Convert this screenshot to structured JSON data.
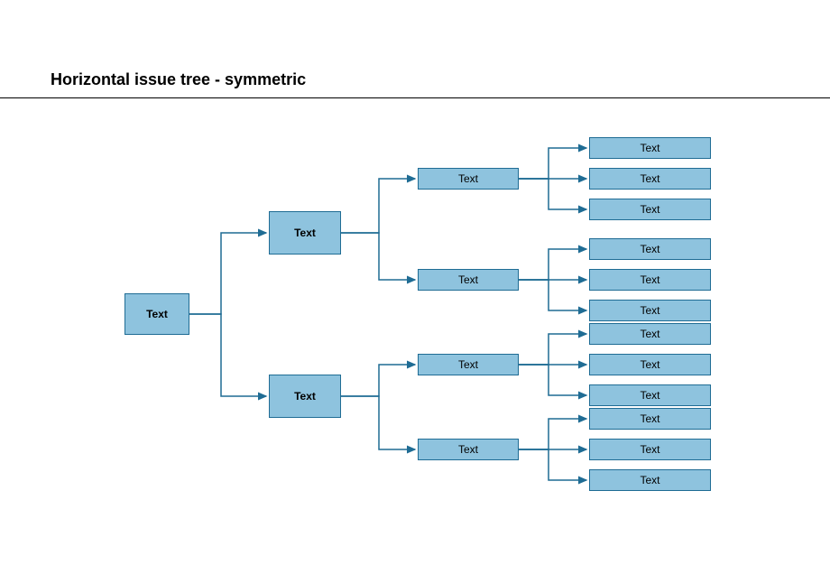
{
  "title": "Horizontal issue tree  - symmetric",
  "colors": {
    "box_fill": "#8ec3de",
    "box_stroke": "#1f6c94",
    "line": "#1f6c94"
  },
  "root": {
    "label": "Text"
  },
  "level2": [
    {
      "label": "Text"
    },
    {
      "label": "Text"
    }
  ],
  "level3": [
    {
      "label": "Text"
    },
    {
      "label": "Text"
    },
    {
      "label": "Text"
    },
    {
      "label": "Text"
    }
  ],
  "level4": [
    {
      "label": "Text"
    },
    {
      "label": "Text"
    },
    {
      "label": "Text"
    },
    {
      "label": "Text"
    },
    {
      "label": "Text"
    },
    {
      "label": "Text"
    },
    {
      "label": "Text"
    },
    {
      "label": "Text"
    },
    {
      "label": "Text"
    },
    {
      "label": "Text"
    },
    {
      "label": "Text"
    },
    {
      "label": "Text"
    }
  ]
}
